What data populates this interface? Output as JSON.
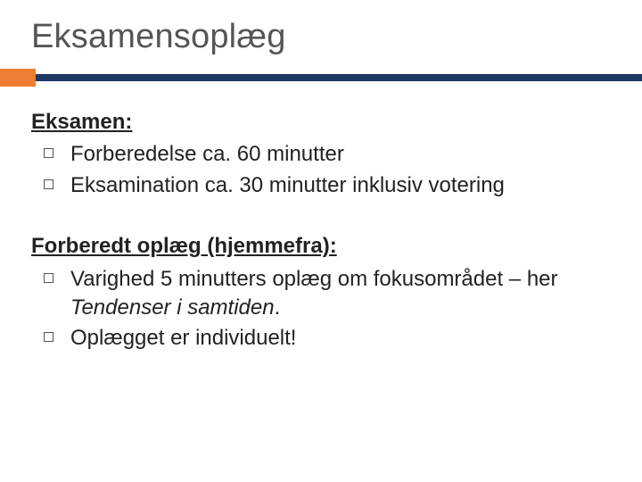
{
  "title": "Eksamensoplæg",
  "section1": {
    "heading": "Eksamen:",
    "items": [
      "Forberedelse ca. 60 minutter",
      "Eksamination ca. 30 minutter inklusiv votering"
    ]
  },
  "section2": {
    "heading": "Forberedt oplæg (hjemmefra):",
    "items": [
      {
        "pre": "Varighed 5 minutters oplæg om fokusområdet – her ",
        "ital": "Tendenser i samtiden",
        "post": "."
      },
      "Oplægget er individuelt!"
    ]
  },
  "colors": {
    "accent": "#ed7d31",
    "bar": "#203864"
  }
}
